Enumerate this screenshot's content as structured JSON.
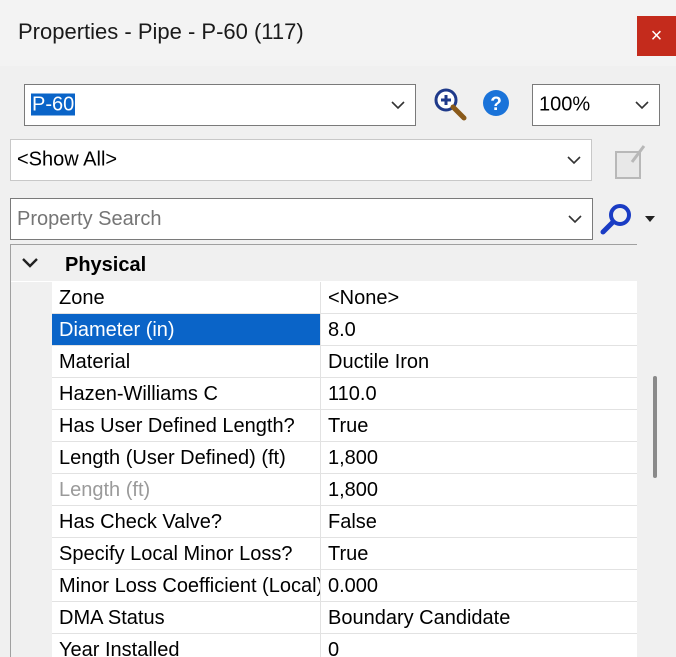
{
  "window": {
    "title": "Properties - Pipe - P-60 (117)",
    "close_glyph": "×"
  },
  "toolbar": {
    "element_selector": {
      "value": "P-60"
    },
    "zoom_icon": "zoom-in-icon",
    "help_icon": "help-icon",
    "zoom_level": "100%"
  },
  "filter": {
    "value": "<Show All>"
  },
  "search": {
    "placeholder": "Property Search"
  },
  "grid": {
    "category": "Physical",
    "rows": [
      {
        "name": "Zone",
        "value": "<None>"
      },
      {
        "name": "Diameter (in)",
        "value": "8.0",
        "selected": true
      },
      {
        "name": "Material",
        "value": "Ductile Iron"
      },
      {
        "name": "Hazen-Williams C",
        "value": "110.0"
      },
      {
        "name": "Has User Defined Length?",
        "value": "True"
      },
      {
        "name": "Length (User Defined) (ft)",
        "value": "1,800"
      },
      {
        "name": "Length (ft)",
        "value": "1,800",
        "disabled": true
      },
      {
        "name": "Has Check Valve?",
        "value": "False"
      },
      {
        "name": "Specify Local Minor Loss?",
        "value": "True"
      },
      {
        "name": "Minor Loss Coefficient (Local)",
        "value": "0.000"
      },
      {
        "name": "DMA Status",
        "value": "Boundary Candidate"
      },
      {
        "name": "Year Installed",
        "value": "0"
      }
    ]
  },
  "colors": {
    "selection": "#0a64c8",
    "close_button": "#c42b1c",
    "help_blue": "#1a73d9"
  }
}
